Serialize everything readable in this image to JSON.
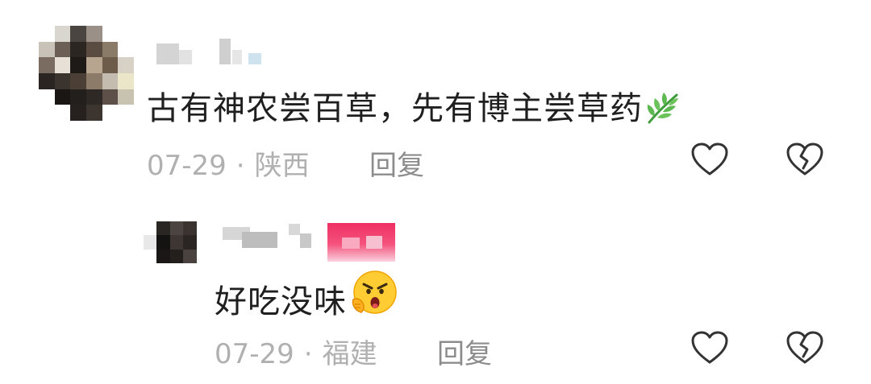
{
  "comments": [
    {
      "text": "古有神农尝百草，先有博主尝草药",
      "emoji": "herb-emoji",
      "date": "07-29",
      "separator": "·",
      "location": "陕西",
      "reply_label": "回复"
    },
    {
      "text": "好吃没味",
      "emoji": "angry-face-emoji",
      "date": "07-29",
      "separator": "·",
      "location": "福建",
      "reply_label": "回复"
    }
  ],
  "icons": {
    "like": "heart-outline-icon",
    "dislike": "broken-heart-outline-icon"
  },
  "colors": {
    "text": "#1f1f1f",
    "meta": "#b0b0b0",
    "reply": "#8c8c8c",
    "icon_stroke": "#333333",
    "badge": "#ef2f63"
  }
}
